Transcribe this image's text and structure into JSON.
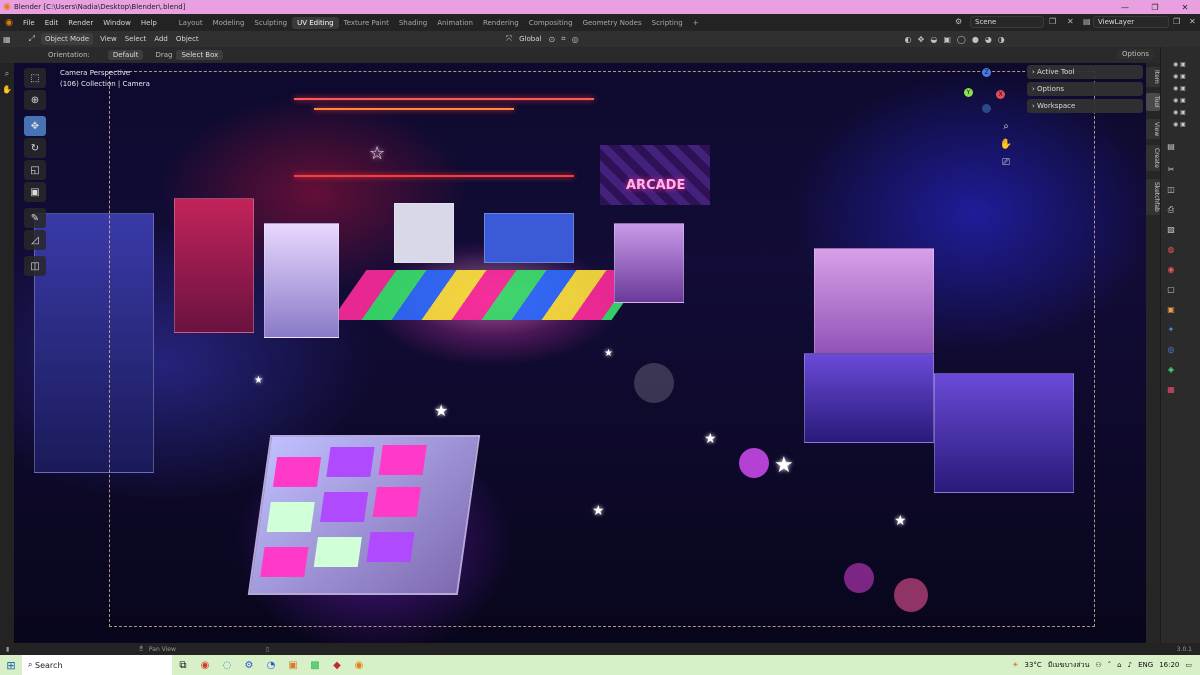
{
  "window": {
    "title": "Blender [C:\\Users\\Nadia\\Desktop\\Blender\\.blend]",
    "minimize": "—",
    "maximize": "❐",
    "close": "✕"
  },
  "menu": [
    "File",
    "Edit",
    "Render",
    "Window",
    "Help"
  ],
  "workspaces": [
    "Layout",
    "Modeling",
    "Sculpting",
    "UV Editing",
    "Texture Paint",
    "Shading",
    "Animation",
    "Rendering",
    "Compositing",
    "Geometry Nodes",
    "Scripting"
  ],
  "active_workspace": "UV Editing",
  "add_workspace": "+",
  "scene": "Scene",
  "view_layer": "ViewLayer",
  "header": {
    "mode": "Object Mode",
    "items": [
      "View",
      "Select",
      "Add",
      "Object"
    ],
    "transform": "Global",
    "options": "Options"
  },
  "tool_settings": {
    "orientation_label": "Orientation:",
    "orientation_value": "Default",
    "drag_label": "Drag",
    "drag_value": "Select Box"
  },
  "viewport": {
    "camera_line1": "Camera Perspective",
    "camera_line2": "(106) Collection | Camera",
    "arcade_sign": "ARCADE"
  },
  "npanel": {
    "rows": [
      "Active Tool",
      "Options",
      "Workspace"
    ],
    "tabs": [
      "Item",
      "Tool",
      "View",
      "Create",
      "Sketchfab"
    ]
  },
  "statusbar": {
    "left": "Pan View",
    "version": "3.0.1"
  },
  "taskbar": {
    "search": "Search",
    "weather": "33°C",
    "weather_desc": "มีเมฆบางส่วน",
    "lang": "ENG",
    "time": "16:20"
  },
  "icons": {
    "blender": "blender-logo-icon",
    "start": "windows-start-icon"
  },
  "colors": {
    "active_tab": "#3a3a3a",
    "accent": "#4772b3",
    "titlebar": "#e8a0e0",
    "taskbar": "#d8f0c8"
  }
}
